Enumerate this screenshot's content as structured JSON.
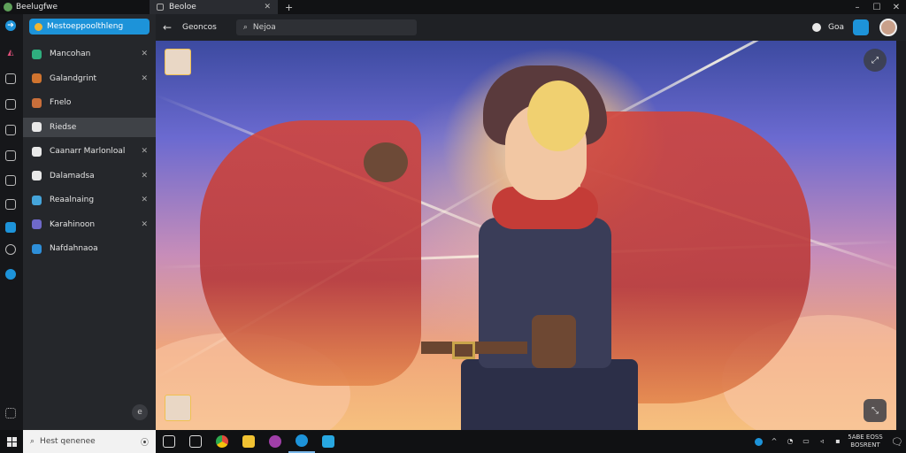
{
  "window": {
    "app_title": "Beelugfwe",
    "tab_title": "Beoloe",
    "tab_close": "✕",
    "new_tab": "+",
    "controls": [
      "–",
      "☐",
      "✕"
    ]
  },
  "toolbar": {
    "back": "←",
    "breadcrumb": "Geoncos",
    "search_value": "Nejoa",
    "label_right": "Goa"
  },
  "sidebar": {
    "top_label": "Mestoeppoolthleng",
    "items": [
      {
        "label": "Mancohan",
        "icon_color": "#2fae7e",
        "active": false,
        "closable": true
      },
      {
        "label": "Galandgrint",
        "icon_color": "#d0742f",
        "active": false,
        "closable": true
      },
      {
        "label": "Fnelo",
        "icon_color": "#c96f3b",
        "active": false,
        "closable": false
      },
      {
        "label": "Riedse",
        "icon_color": "#e9e9e9",
        "active": true,
        "closable": false
      },
      {
        "label": "Caanarr Marlonloal",
        "icon_color": "#e9e9e9",
        "active": false,
        "closable": true
      },
      {
        "label": "Dalamadsa",
        "icon_color": "#e9e9e9",
        "active": false,
        "closable": true
      },
      {
        "label": "Reaalnaing",
        "icon_color": "#45a4da",
        "active": false,
        "closable": true
      },
      {
        "label": "Karahinoon",
        "icon_color": "#6f69c9",
        "active": false,
        "closable": true
      },
      {
        "label": "Nafdahnaoa",
        "icon_color": "#2e8fd9",
        "active": false,
        "closable": false
      }
    ],
    "close_glyph": "✕",
    "bottom_button": "e"
  },
  "viewer": {
    "corner_button_top": "⤢",
    "corner_button_bottom": "⤡"
  },
  "taskbar": {
    "search_placeholder": "Hest qenenee",
    "search_mic": "⦿",
    "clock_line1": "5ABE EOSS",
    "clock_line2": "BOSRENT",
    "notification": "🗨"
  },
  "colors": {
    "accent": "#1d93d9",
    "sidebar_bg": "#25272b",
    "rail_bg": "#16171a"
  }
}
